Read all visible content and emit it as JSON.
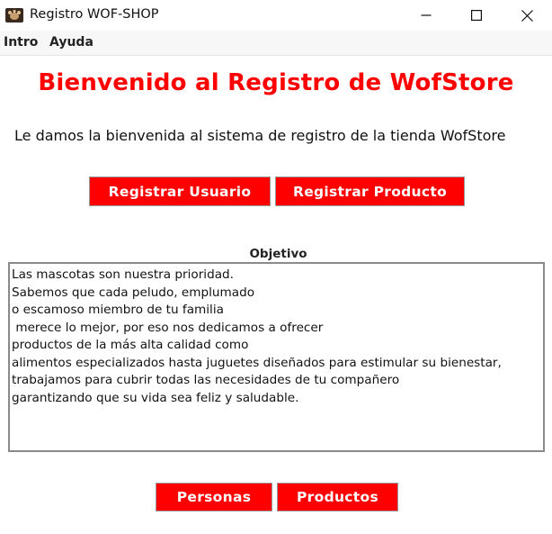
{
  "window": {
    "title": "Registro WOF-SHOP",
    "icon": "pet-paw-icon"
  },
  "menubar": {
    "items": [
      {
        "label": "Intro"
      },
      {
        "label": "Ayuda"
      }
    ]
  },
  "header": {
    "title": "Bienvenido al Registro de WofStore"
  },
  "welcome_text": "Le damos la bienvenida al sistema de registro de la tienda WofStore",
  "actions": {
    "register_user": "Registrar Usuario",
    "register_product": "Registrar Producto"
  },
  "objective": {
    "label": "Objetivo",
    "lines": [
      "Las mascotas son nuestra prioridad.",
      "Sabemos que cada peludo, emplumado",
      "o escamoso miembro de tu familia",
      " merece lo mejor, por eso nos dedicamos a ofrecer",
      "productos de la más alta calidad como",
      "alimentos especializados hasta juguetes diseñados para estimular su bienestar,",
      "trabajamos para cubrir todas las necesidades de tu compañero",
      "garantizando que su vida sea feliz y saludable."
    ]
  },
  "footer_buttons": {
    "people": "Personas",
    "products": "Productos"
  },
  "colors": {
    "accent": "#ff0000",
    "button_text": "#ffffff"
  }
}
